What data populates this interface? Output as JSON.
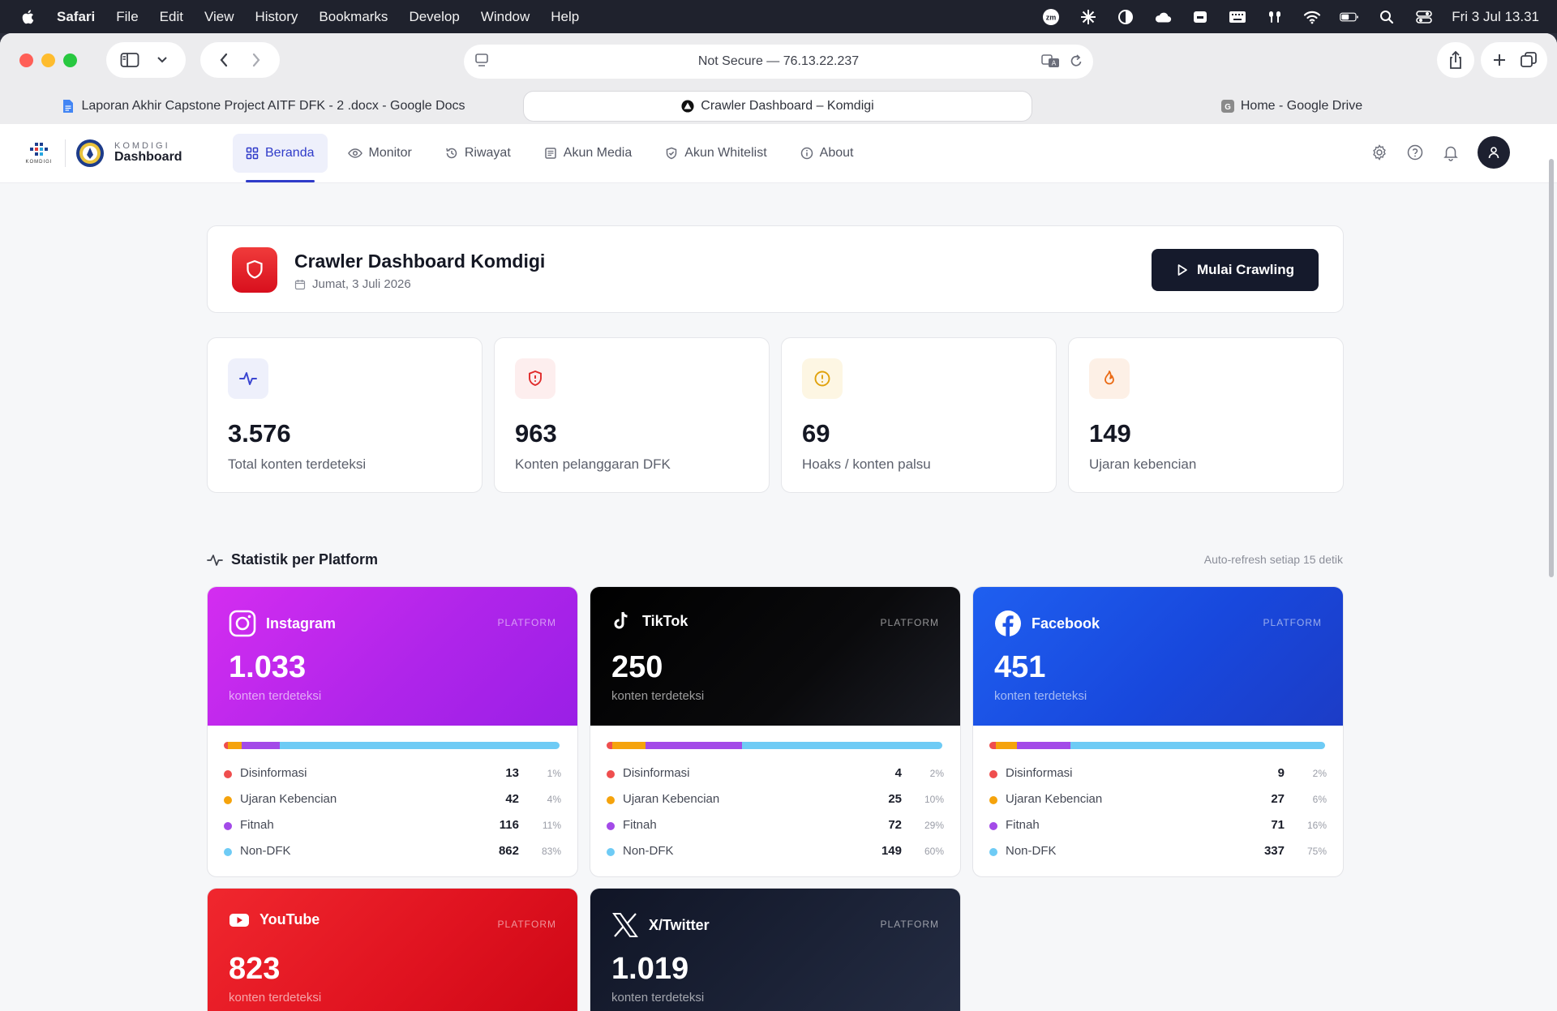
{
  "menubar": {
    "app": "Safari",
    "items": [
      "File",
      "Edit",
      "View",
      "History",
      "Bookmarks",
      "Develop",
      "Window",
      "Help"
    ],
    "clock": "Fri 3 Jul  13.31"
  },
  "browser": {
    "address": "Not Secure — 76.13.22.237",
    "tabs": [
      {
        "label": "Laporan Akhir Capstone Project AITF DFK - 2 .docx - Google Docs",
        "color": "#4285f4"
      },
      {
        "label": "Crawler Dashboard – Komdigi",
        "color": "#111111"
      },
      {
        "label": "Home - Google Drive",
        "color": "#8a8a8a"
      }
    ]
  },
  "appnav": {
    "brand_small": "KOMDIGI",
    "brand_big": "Dashboard",
    "logo_text": "KOMDIGI",
    "items": [
      {
        "label": "Beranda",
        "icon": "grid-icon"
      },
      {
        "label": "Monitor",
        "icon": "eye-icon"
      },
      {
        "label": "Riwayat",
        "icon": "history-icon"
      },
      {
        "label": "Akun Media",
        "icon": "newspaper-icon"
      },
      {
        "label": "Akun Whitelist",
        "icon": "shield-check-icon"
      },
      {
        "label": "About",
        "icon": "info-icon"
      }
    ]
  },
  "hero": {
    "title": "Crawler Dashboard Komdigi",
    "date": "Jumat, 3 Juli 2026",
    "button": "Mulai Crawling"
  },
  "stats": [
    {
      "value": "3.576",
      "label": "Total konten terdeteksi",
      "icon": "activity-icon",
      "bg": "#eef0fb",
      "fg": "#3b46d1"
    },
    {
      "value": "963",
      "label": "Konten pelanggaran DFK",
      "icon": "shield-alert-icon",
      "bg": "#fdeeee",
      "fg": "#e02b2b"
    },
    {
      "value": "69",
      "label": "Hoaks / konten palsu",
      "icon": "alert-circle-icon",
      "bg": "#fdf6e3",
      "fg": "#e0a10b"
    },
    {
      "value": "149",
      "label": "Ujaran kebencian",
      "icon": "flame-icon",
      "bg": "#fdf0e6",
      "fg": "#ea6a14"
    }
  ],
  "section": {
    "title": "Statistik per Platform",
    "note": "Auto-refresh setiap 15 detik"
  },
  "categories": [
    {
      "name": "Disinformasi",
      "color": "#ef4e4e"
    },
    {
      "name": "Ujaran Kebencian",
      "color": "#f5a30c"
    },
    {
      "name": "Fitnah",
      "color": "#a34ae8"
    },
    {
      "name": "Non-DFK",
      "color": "#6ecbf5"
    }
  ],
  "platforms": [
    {
      "name": "Instagram",
      "tag": "PLATFORM",
      "count": "1.033",
      "sub": "konten terdeteksi",
      "icon": "instagram-icon",
      "values": [
        "13",
        "42",
        "116",
        "862"
      ],
      "pcts": [
        "1%",
        "4%",
        "11%",
        "83%"
      ],
      "fractions": [
        1.3,
        4.1,
        11.2,
        83.4
      ]
    },
    {
      "name": "TikTok",
      "tag": "PLATFORM",
      "count": "250",
      "sub": "konten terdeteksi",
      "icon": "tiktok-icon",
      "values": [
        "4",
        "25",
        "72",
        "149"
      ],
      "pcts": [
        "2%",
        "10%",
        "29%",
        "60%"
      ],
      "fractions": [
        1.6,
        10,
        28.8,
        59.6
      ]
    },
    {
      "name": "Facebook",
      "tag": "PLATFORM",
      "count": "451",
      "sub": "konten terdeteksi",
      "icon": "facebook-icon",
      "values": [
        "9",
        "27",
        "71",
        "337"
      ],
      "pcts": [
        "2%",
        "6%",
        "16%",
        "75%"
      ],
      "fractions": [
        2,
        6.1,
        16,
        75.9
      ]
    },
    {
      "name": "YouTube",
      "tag": "PLATFORM",
      "count": "823",
      "sub": "konten terdeteksi",
      "icon": "youtube-icon"
    },
    {
      "name": "X/Twitter",
      "tag": "PLATFORM",
      "count": "1.019",
      "sub": "konten terdeteksi",
      "icon": "x-twitter-icon"
    }
  ]
}
